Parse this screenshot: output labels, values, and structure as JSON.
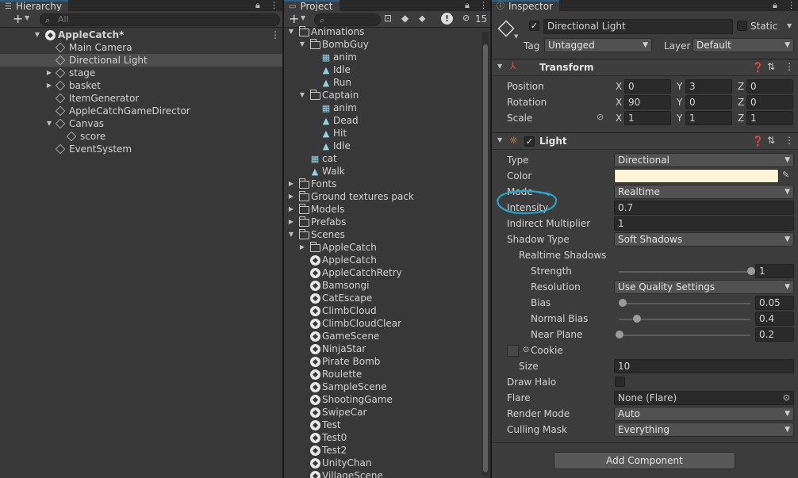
{
  "hierarchy": {
    "tab": "Hierarchy",
    "add_label": "+",
    "search_placeholder": "All",
    "root": "AppleCatch*",
    "items": [
      {
        "label": "Main Camera"
      },
      {
        "label": "Directional Light"
      },
      {
        "label": "stage"
      },
      {
        "label": "basket"
      },
      {
        "label": "ItemGenerator"
      },
      {
        "label": "AppleCatchGameDirector"
      },
      {
        "label": "Canvas"
      },
      {
        "label": "score"
      },
      {
        "label": "EventSystem"
      }
    ]
  },
  "project": {
    "tab": "Project",
    "add_label": "+",
    "hidden_count": "15",
    "items": [
      {
        "label": "Animations"
      },
      {
        "label": "BombGuy"
      },
      {
        "label": "anim"
      },
      {
        "label": "Idle"
      },
      {
        "label": "Run"
      },
      {
        "label": "Captain"
      },
      {
        "label": "anim"
      },
      {
        "label": "Dead"
      },
      {
        "label": "Hit"
      },
      {
        "label": "Idle"
      },
      {
        "label": "cat"
      },
      {
        "label": "Walk"
      },
      {
        "label": "Fonts"
      },
      {
        "label": "Ground textures pack"
      },
      {
        "label": "Models"
      },
      {
        "label": "Prefabs"
      },
      {
        "label": "Scenes"
      },
      {
        "label": "AppleCatch"
      },
      {
        "label": "AppleCatch"
      },
      {
        "label": "AppleCatchRetry"
      },
      {
        "label": "Bamsongi"
      },
      {
        "label": "CatEscape"
      },
      {
        "label": "ClimbCloud"
      },
      {
        "label": "ClimbCloudClear"
      },
      {
        "label": "GameScene"
      },
      {
        "label": "NinjaStar"
      },
      {
        "label": "Pirate Bomb"
      },
      {
        "label": "Roulette"
      },
      {
        "label": "SampleScene"
      },
      {
        "label": "ShootingGame"
      },
      {
        "label": "SwipeCar"
      },
      {
        "label": "Test"
      },
      {
        "label": "Test0"
      },
      {
        "label": "Test2"
      },
      {
        "label": "UnityChan"
      },
      {
        "label": "VillageScene"
      }
    ]
  },
  "inspector": {
    "tab": "Inspector",
    "object_name": "Directional Light",
    "static_label": "Static",
    "tag_label": "Tag",
    "tag_value": "Untagged",
    "layer_label": "Layer",
    "layer_value": "Default",
    "transform": {
      "title": "Transform",
      "position_label": "Position",
      "rotation_label": "Rotation",
      "scale_label": "Scale",
      "x": "X",
      "y": "Y",
      "z": "Z",
      "position": [
        "0",
        "3",
        "0"
      ],
      "rotation": [
        "90",
        "0",
        "0"
      ],
      "scale": [
        "1",
        "1",
        "1"
      ]
    },
    "light": {
      "title": "Light",
      "type_label": "Type",
      "type_value": "Directional",
      "color_label": "Color",
      "color_value": "#fff4d6",
      "mode_label": "Mode",
      "mode_value": "Realtime",
      "intensity_label": "Intensity",
      "intensity_value": "0.7",
      "indirect_label": "Indirect Multiplier",
      "indirect_value": "1",
      "shadow_type_label": "Shadow Type",
      "shadow_type_value": "Soft Shadows",
      "realtime_shadows_label": "Realtime Shadows",
      "strength_label": "Strength",
      "strength_value": "1",
      "strength_fraction": 1.0,
      "resolution_label": "Resolution",
      "resolution_value": "Use Quality Settings",
      "bias_label": "Bias",
      "bias_value": "0.05",
      "bias_fraction": 0.025,
      "normal_bias_label": "Normal Bias",
      "normal_bias_value": "0.4",
      "normal_bias_fraction": 0.133,
      "near_plane_label": "Near Plane",
      "near_plane_value": "0.2",
      "near_plane_fraction": 0.0,
      "cookie_label": "Cookie",
      "size_label": "Size",
      "size_value": "10",
      "draw_halo_label": "Draw Halo",
      "flare_label": "Flare",
      "flare_value": "None (Flare)",
      "render_mode_label": "Render Mode",
      "render_mode_value": "Auto",
      "culling_mask_label": "Culling Mask",
      "culling_mask_value": "Everything"
    },
    "add_component_label": "Add Component",
    "annotation_color": "#2aa3c8"
  }
}
